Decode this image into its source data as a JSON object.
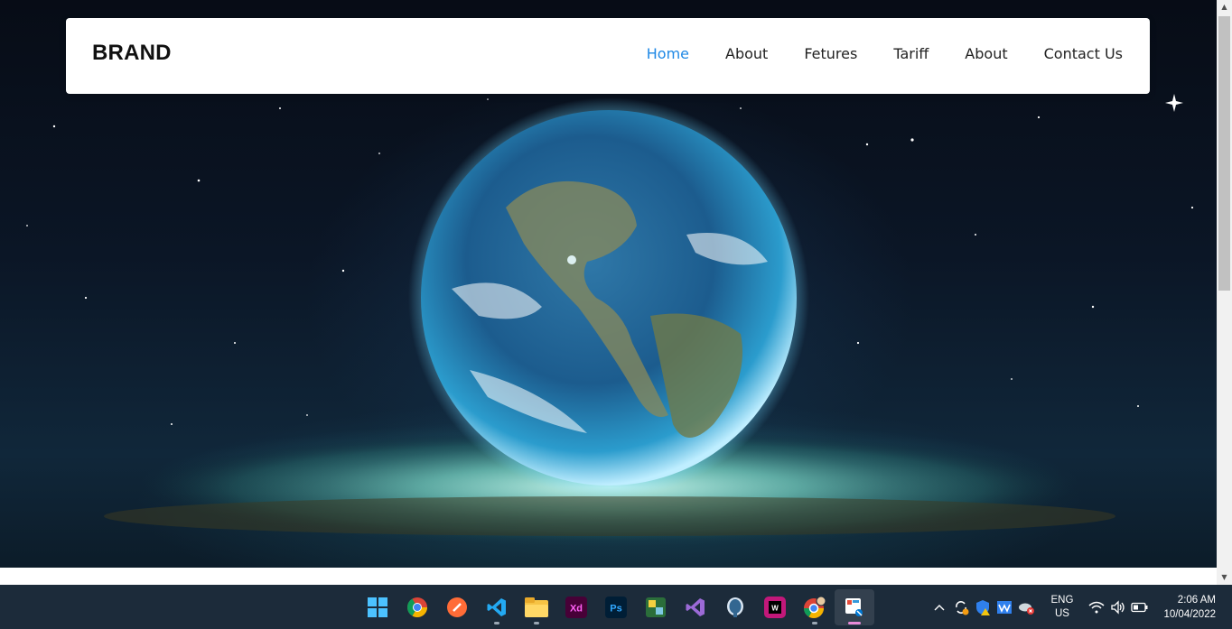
{
  "navbar": {
    "brand": "BRAND",
    "links": [
      "Home",
      "About",
      "Fetures",
      "Tariff",
      "About",
      "Contact Us"
    ],
    "active_index": 0
  },
  "colors": {
    "active_link": "#1e88e5",
    "taskbar_bg": "#1c2b3a"
  },
  "taskbar": {
    "apps": [
      "windows-start-icon",
      "chrome-icon",
      "postman-icon",
      "vscode-icon",
      "file-explorer-icon",
      "adobe-xd-icon",
      "photoshop-icon",
      "app-icon",
      "visual-studio-icon",
      "postgresql-icon",
      "webstorm-icon",
      "chrome-profile-icon",
      "snipping-tool-icon"
    ],
    "tray": {
      "language": "ENG",
      "region": "US",
      "time": "2:06 AM",
      "date": "10/04/2022"
    }
  }
}
